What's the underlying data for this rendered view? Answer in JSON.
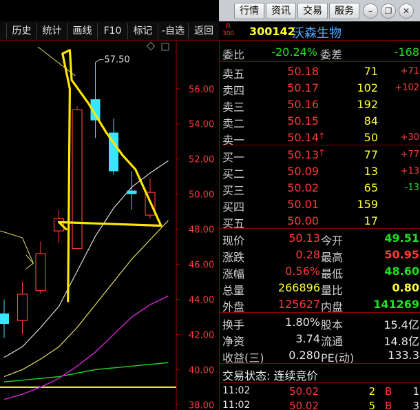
{
  "titlebar": {
    "buttons": [
      "行情",
      "资讯",
      "交易",
      "服务"
    ],
    "window_icons": [
      "minimize-icon",
      "restore-icon",
      "close-icon"
    ]
  },
  "toolbar": {
    "items": [
      "历史",
      "统计",
      "画线",
      "F10",
      "标记",
      "-自选",
      "返回"
    ]
  },
  "stock": {
    "badge_r": "R",
    "badge_code": "300",
    "code": "300142",
    "name": "沃森生物"
  },
  "weibi": {
    "label1": "委比",
    "value1": "-20.24%",
    "label2": "委差",
    "value2": "-168"
  },
  "sell": [
    {
      "label": "卖五",
      "price": "50.18",
      "vol": "71",
      "chg": "+71"
    },
    {
      "label": "卖四",
      "price": "50.17",
      "vol": "102",
      "chg": "+102"
    },
    {
      "label": "卖三",
      "price": "50.16",
      "vol": "192",
      "chg": ""
    },
    {
      "label": "卖二",
      "price": "50.15",
      "vol": "84",
      "chg": ""
    },
    {
      "label": "卖一",
      "price": "50.14",
      "vol": "50",
      "chg": "+30"
    }
  ],
  "buy": [
    {
      "label": "买一",
      "price": "50.13",
      "vol": "77",
      "chg": "+77",
      "chg_color": "red"
    },
    {
      "label": "买二",
      "price": "50.09",
      "vol": "13",
      "chg": "+13",
      "chg_color": "red"
    },
    {
      "label": "买三",
      "price": "50.02",
      "vol": "65",
      "chg": "-13",
      "chg_color": "green"
    },
    {
      "label": "买四",
      "price": "50.01",
      "vol": "159",
      "chg": "",
      "chg_color": "red"
    },
    {
      "label": "买五",
      "price": "50.00",
      "vol": "17",
      "chg": "",
      "chg_color": "red"
    }
  ],
  "stats": [
    {
      "l1": "现价",
      "v1": "50.13",
      "l2": "今开",
      "v2": "49.51",
      "c1": "red",
      "c2": "green"
    },
    {
      "l1": "涨跌",
      "v1": "0.28",
      "l2": "最高",
      "v2": "50.95",
      "c1": "red",
      "c2": "red"
    },
    {
      "l1": "涨幅",
      "v1": "0.56%",
      "l2": "最低",
      "v2": "48.60",
      "c1": "red",
      "c2": "green"
    },
    {
      "l1": "总量",
      "v1": "266896",
      "l2": "量比",
      "v2": "0.80",
      "c1": "yellow",
      "c2": "yellow"
    },
    {
      "l1": "外盘",
      "v1": "125627",
      "l2": "内盘",
      "v2": "141269",
      "c1": "red",
      "c2": "green"
    }
  ],
  "stats2": [
    {
      "l1": "换手",
      "v1": "1.80%",
      "l2": "股本",
      "v2": "15.4亿"
    },
    {
      "l1": "净资",
      "v1": "3.74",
      "l2": "流通",
      "v2": "14.8亿"
    },
    {
      "l1": "收益(三)",
      "v1": "0.280",
      "l2": "PE(动)",
      "v2": "133.3"
    }
  ],
  "trade_status": "交易状态: 连续竞价",
  "ticks": [
    {
      "time": "11:02",
      "price": "50.02",
      "vol": "2",
      "side": "B",
      "extra": "1"
    },
    {
      "time": "11:02",
      "price": "50.02",
      "vol": "5",
      "side": "B",
      "extra": "3"
    }
  ],
  "colors": {
    "up": "#ff3b3b",
    "down": "#22e022",
    "label": "#d0d0d0",
    "accent": "#ffff33",
    "grid": "#8b0000",
    "cyan_candle": "#39e6ff"
  },
  "chart_data": {
    "type": "candlestick",
    "y_ticks": [
      "56.00",
      "54.00",
      "52.00",
      "50.00",
      "48.00",
      "46.00",
      "44.00",
      "42.00",
      "40.00",
      "38.00"
    ],
    "ylim": [
      37.7,
      58.7
    ],
    "high_label": "57.50",
    "candles": [
      {
        "open": 42.6,
        "close": 43.2,
        "high": 44.0,
        "low": 41.8,
        "up": false
      },
      {
        "open": 42.8,
        "close": 44.3,
        "high": 45.0,
        "low": 42.0,
        "up": true
      },
      {
        "open": 44.5,
        "close": 46.6,
        "high": 47.3,
        "low": 44.3,
        "up": true
      },
      {
        "open": 47.9,
        "close": 48.6,
        "high": 49.1,
        "low": 47.2,
        "up": true
      },
      {
        "open": 46.9,
        "close": 54.8,
        "high": 55.0,
        "low": 46.9,
        "up": true
      },
      {
        "open": 55.4,
        "close": 54.2,
        "high": 57.5,
        "low": 53.2,
        "up": false
      },
      {
        "open": 53.5,
        "close": 51.3,
        "high": 54.3,
        "low": 51.1,
        "up": false
      },
      {
        "open": 50.2,
        "close": 50.0,
        "high": 51.3,
        "low": 49.1,
        "up": false
      },
      {
        "open": 48.8,
        "close": 50.1,
        "high": 50.9,
        "low": 48.6,
        "up": true
      }
    ],
    "ma_white": [
      40.7,
      41.3,
      42.4,
      43.6,
      45.6,
      47.6,
      49.2,
      50.4,
      51.2,
      51.9
    ],
    "ma_yellow": [
      39.6,
      40.0,
      40.6,
      41.3,
      42.4,
      43.7,
      45.0,
      46.3,
      47.4,
      48.5
    ],
    "ma_green": [
      39.3,
      39.4,
      39.5,
      39.6,
      39.8,
      40.0,
      40.1,
      40.2,
      40.3,
      40.4
    ],
    "ma_magenta": [
      38.3,
      38.6,
      39.0,
      39.5,
      40.2,
      41.0,
      42.0,
      43.0,
      43.7,
      44.2
    ],
    "support_line": 39.0,
    "annotation_triangle": [
      [
        51.0,
        2
      ],
      [
        49.1,
        2
      ],
      [
        48.3,
        8.7
      ]
    ]
  }
}
